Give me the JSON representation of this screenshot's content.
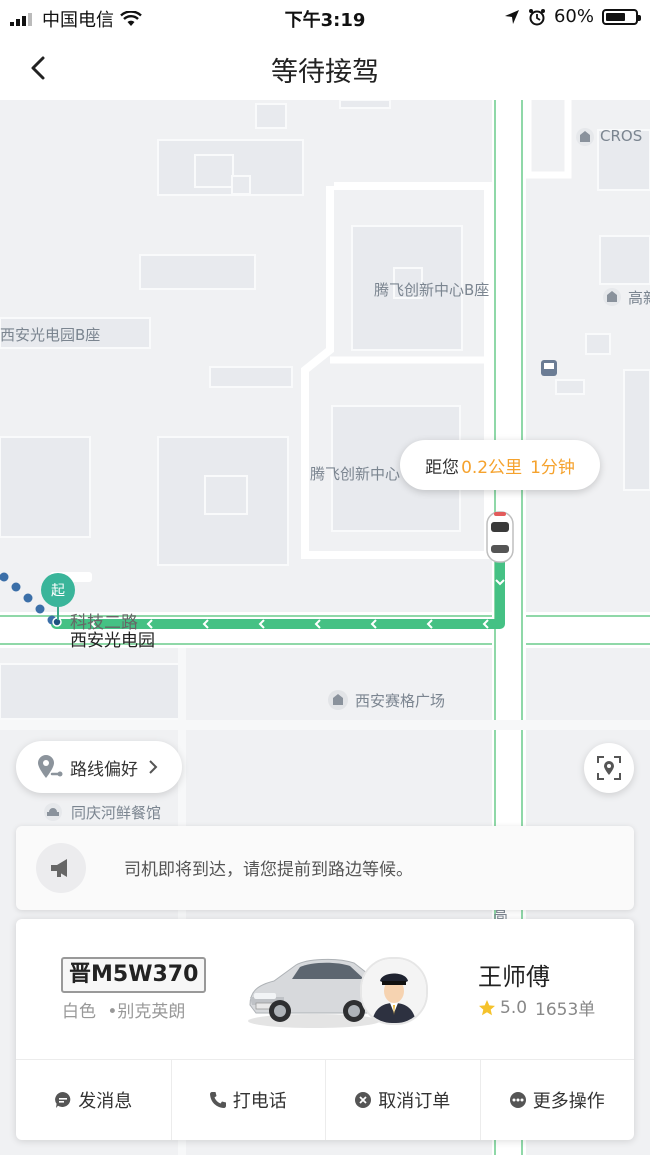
{
  "status_bar": {
    "carrier": "中国电信",
    "time": "下午3:19",
    "battery": "60%"
  },
  "nav": {
    "title": "等待接驾"
  },
  "map": {
    "labels": {
      "cros": "CROS",
      "tengfei_b": "腾飞创新中心B座",
      "xian_b": "西安光电园B座",
      "gao": "高新",
      "tengfei": "腾飞创新中心",
      "road": "科技二路",
      "xian_park": "西安光电园",
      "saige": "西安赛格广场",
      "tongqing": "同庆河鲜餐馆",
      "gao2": "高"
    },
    "start_marker": "起",
    "distance_bubble": {
      "prefix": "距您",
      "distance": "0.2公里",
      "time": "1分钟"
    },
    "route_pref_label": "路线偏好",
    "route_color": "#45c184"
  },
  "notice": {
    "text": "司机即将到达，请您提前到路边等候。"
  },
  "driver_card": {
    "plate": "晋M5W370",
    "car_color": "白色",
    "car_model": "•别克英朗",
    "driver_name": "王师傅",
    "rating": "5.0",
    "orders": "1653单",
    "actions": [
      {
        "label": "发消息",
        "icon": "message-icon"
      },
      {
        "label": "打电话",
        "icon": "phone-icon"
      },
      {
        "label": "取消订单",
        "icon": "cancel-icon"
      },
      {
        "label": "更多操作",
        "icon": "more-icon"
      }
    ]
  }
}
